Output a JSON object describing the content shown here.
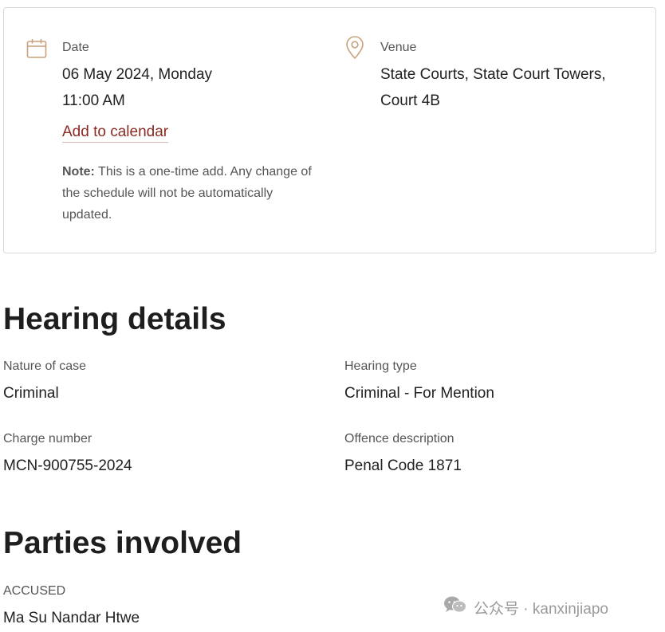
{
  "schedule_card": {
    "date": {
      "icon": "calendar-icon",
      "label": "Date",
      "value": "06 May 2024, Monday",
      "time": "11:00 AM",
      "add_to_calendar": "Add to calendar",
      "note_prefix": "Note:",
      "note_text": "This is a one-time add. Any change of the schedule will not be automatically updated."
    },
    "venue": {
      "icon": "location-pin-icon",
      "label": "Venue",
      "line1": "State Courts, State Court Towers,",
      "line2": "Court 4B"
    }
  },
  "hearing_details": {
    "title": "Hearing details",
    "nature_of_case": {
      "label": "Nature of case",
      "value": "Criminal"
    },
    "hearing_type": {
      "label": "Hearing type",
      "value": "Criminal - For Mention"
    },
    "charge_number": {
      "label": "Charge number",
      "value": "MCN-900755-2024"
    },
    "offence_description": {
      "label": "Offence description",
      "value": "Penal Code 1871"
    }
  },
  "parties_involved": {
    "title": "Parties involved",
    "accused": {
      "label": "ACCUSED",
      "value": "Ma Su Nandar Htwe"
    }
  },
  "watermark": {
    "icon": "wechat-icon",
    "text": "公众号 · kanxinjiapo"
  },
  "colors": {
    "accent_link": "#8a2b22",
    "icon_tan": "#c9a27a",
    "border": "#d9d9d9"
  }
}
